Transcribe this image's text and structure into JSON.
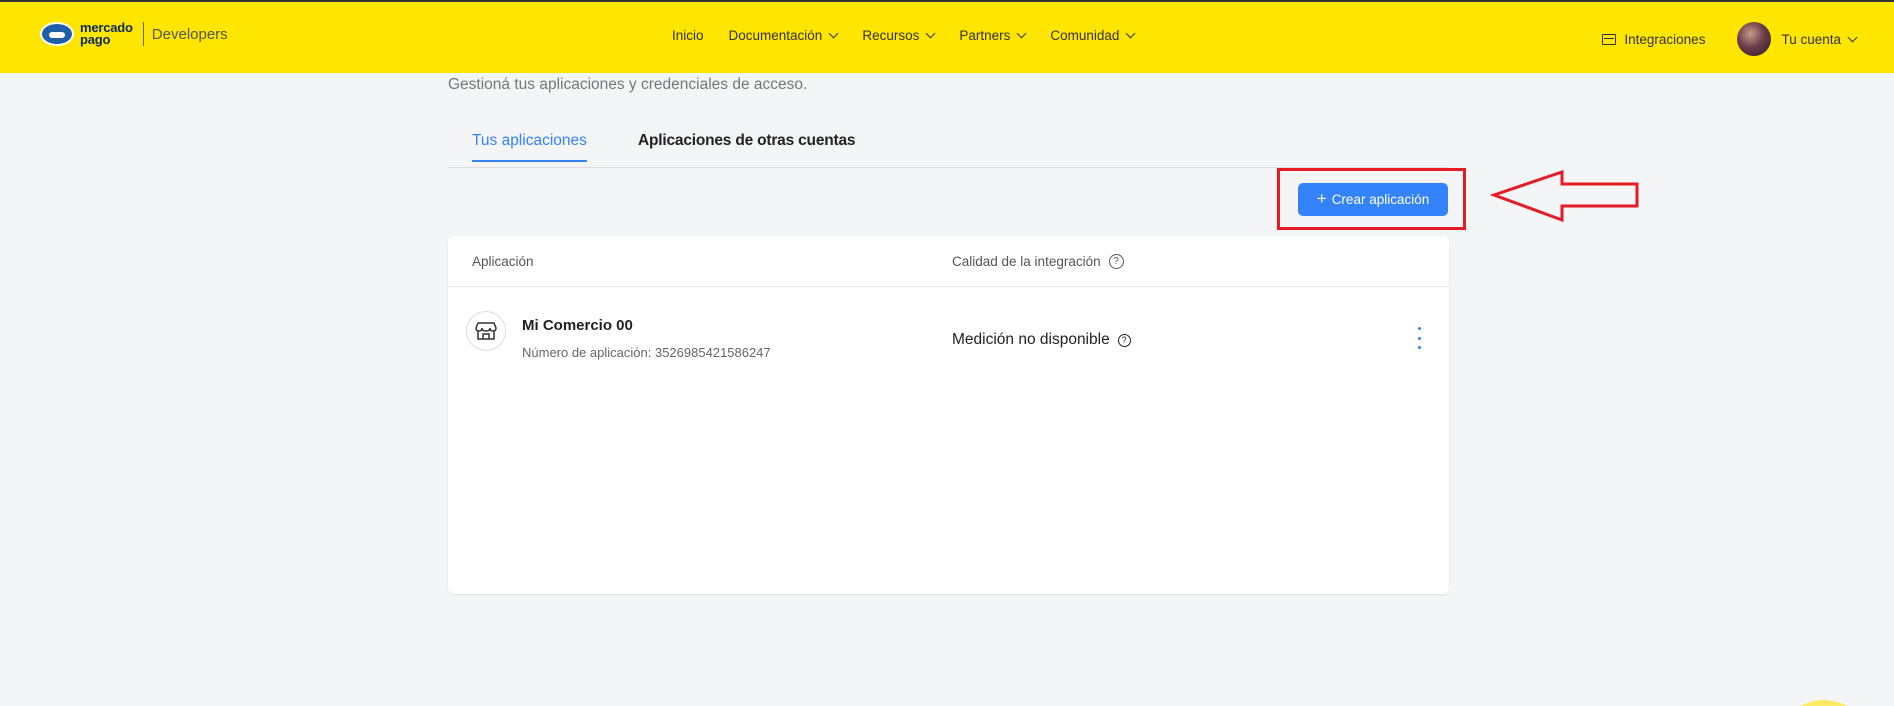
{
  "header": {
    "logo_line1": "mercado",
    "logo_line2": "pago",
    "logo_product": "Developers",
    "nav": [
      {
        "label": "Inicio",
        "has_dropdown": false
      },
      {
        "label": "Documentación",
        "has_dropdown": true
      },
      {
        "label": "Recursos",
        "has_dropdown": true
      },
      {
        "label": "Partners",
        "has_dropdown": true
      },
      {
        "label": "Comunidad",
        "has_dropdown": true
      }
    ],
    "integrations_label": "Integraciones",
    "account_label": "Tu cuenta",
    "background_color": "#ffe600"
  },
  "page": {
    "subtitle": "Gestioná tus aplicaciones y credenciales de acceso.",
    "tabs": [
      {
        "label": "Tus aplicaciones",
        "active": true
      },
      {
        "label": "Aplicaciones de otras cuentas",
        "active": false
      }
    ],
    "create_button_label": "Crear aplicación",
    "accent_color": "#3483fa",
    "annotation_color": "#e51c23"
  },
  "table": {
    "columns": [
      "Aplicación",
      "Calidad de la integración"
    ],
    "rows": [
      {
        "name": "Mi Comercio 00",
        "number_label": "Número de aplicación: 3526985421586247",
        "quality": "Medición no disponible"
      }
    ]
  },
  "icons": {
    "help": "?",
    "plus": "+"
  }
}
